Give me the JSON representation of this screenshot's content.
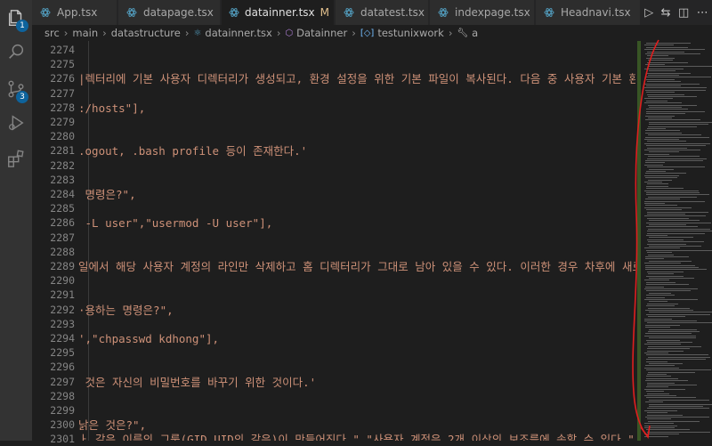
{
  "activity_bar": {
    "items": [
      {
        "name": "explorer",
        "badge": "1"
      },
      {
        "name": "search",
        "badge": ""
      },
      {
        "name": "source-control",
        "badge": "3"
      },
      {
        "name": "run-debug",
        "badge": ""
      },
      {
        "name": "extensions",
        "badge": ""
      }
    ]
  },
  "tabs": [
    {
      "label": "App.tsx",
      "active": false
    },
    {
      "label": "datapage.tsx",
      "active": false
    },
    {
      "label": "datainner.tsx",
      "active": true,
      "modified": "M"
    },
    {
      "label": "datatest.tsx",
      "active": false
    },
    {
      "label": "indexpage.tsx",
      "active": false
    },
    {
      "label": "Headnavi.tsx",
      "active": false
    }
  ],
  "breadcrumb": {
    "src": "src",
    "main": "main",
    "datastructure": "datastructure",
    "file": "datainner.tsx",
    "component": "Datainner",
    "variable": "testunixwork",
    "property": "a"
  },
  "line_numbers": [
    "2274",
    "2275",
    "2276",
    "2277",
    "2278",
    "2279",
    "2280",
    "2281",
    "2282",
    "2283",
    "2284",
    "2285",
    "2286",
    "2287",
    "2288",
    "2289",
    "2290",
    "2291",
    "2292",
    "2293",
    "2294",
    "2295",
    "2296",
    "2297",
    "2298",
    "2299",
    "2300",
    "2301"
  ],
  "code_lines": [
    "",
    "",
    "|렉터리에 기본 사용자 디렉터리가 생성되고, 환경 설정을 위한 기본 파일이 복사된다. 다음 중 사용자 기본 환",
    "",
    ":/hosts\"],",
    "",
    "",
    ".ogout, .bash profile 등이 존재한다.'",
    "",
    "",
    " 명령은?\",",
    "",
    " -L user\",\"usermod -U user\"],",
    "",
    "",
    "일에서 해당 사용자 계정의 라인만 삭제하고 홈 디렉터리가 그대로 남아 있을 수 있다. 이러한 경우 차후에 새로",
    "",
    "",
    "·용하는 명령은?\",",
    "",
    "',\"chpasswd kdhong\"],",
    "",
    "",
    " 것은 자신의 비밀번호를 바꾸기 위한 것이다.'",
    "",
    "",
    "낡은 것은?\",",
    "ㅏ 같은 이름의 그룹(GID UID의 같은)이 만들어진다.\",\"사용자 계정은 2개 이상의 보조를에 속할 수 있다.\",\""
  ]
}
